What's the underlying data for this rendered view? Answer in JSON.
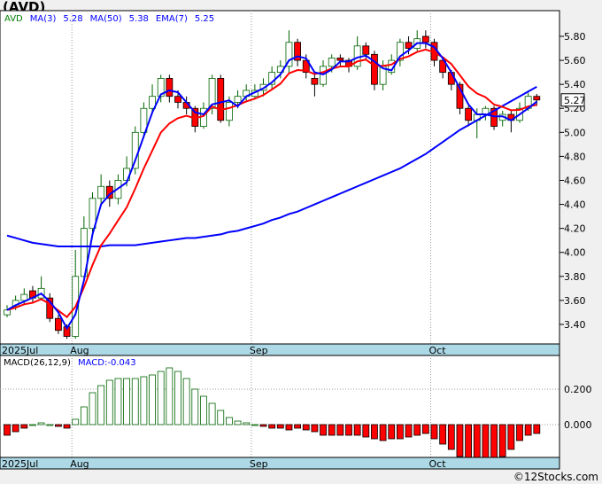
{
  "title": "(AVD)",
  "footer": "©12Stocks.com",
  "chart_data": [
    {
      "type": "candlestick",
      "legend": {
        "ticker": "AVD",
        "ma3_label": "MA(3)",
        "ma3_value": "5.28",
        "ma50_label": "MA(50)",
        "ma50_value": "5.38",
        "ema7_label": "EMA(7)",
        "ema7_value": "5.25"
      },
      "ylim": [
        3.25,
        5.95
      ],
      "yticks": [
        "3.40",
        "3.60",
        "3.80",
        "4.00",
        "4.20",
        "4.40",
        "4.60",
        "4.80",
        "5.00",
        "5.20",
        "5.40",
        "5.60",
        "5.80"
      ],
      "last_price": "5.27",
      "xticks": [
        {
          "label": "2025Jul",
          "index": 0
        },
        {
          "label": "Aug",
          "index": 8
        },
        {
          "label": "Sep",
          "index": 29
        },
        {
          "label": "Oct",
          "index": 50
        }
      ],
      "colors": {
        "up": "#ffffff",
        "down": "#ff0000",
        "ma": "#0000ff",
        "ema": "#ff0000",
        "grid": "#999999",
        "band": "#add8e6"
      },
      "candles": [
        [
          3.48,
          3.56,
          3.46,
          3.52
        ],
        [
          3.55,
          3.64,
          3.52,
          3.6
        ],
        [
          3.6,
          3.7,
          3.56,
          3.65
        ],
        [
          3.68,
          3.72,
          3.58,
          3.62
        ],
        [
          3.62,
          3.8,
          3.6,
          3.7
        ],
        [
          3.62,
          3.66,
          3.42,
          3.45
        ],
        [
          3.45,
          3.48,
          3.32,
          3.35
        ],
        [
          3.38,
          3.4,
          3.28,
          3.3
        ],
        [
          3.3,
          4.02,
          3.28,
          3.8
        ],
        [
          3.8,
          4.3,
          3.78,
          4.2
        ],
        [
          4.2,
          4.5,
          4.15,
          4.45
        ],
        [
          4.45,
          4.65,
          4.4,
          4.55
        ],
        [
          4.55,
          4.6,
          4.38,
          4.45
        ],
        [
          4.45,
          4.65,
          4.4,
          4.6
        ],
        [
          4.6,
          4.8,
          4.55,
          4.7
        ],
        [
          4.7,
          5.05,
          4.65,
          5.0
        ],
        [
          5.0,
          5.25,
          4.95,
          5.2
        ],
        [
          5.2,
          5.4,
          5.15,
          5.3
        ],
        [
          5.3,
          5.48,
          5.25,
          5.45
        ],
        [
          5.45,
          5.48,
          5.25,
          5.3
        ],
        [
          5.3,
          5.35,
          5.2,
          5.25
        ],
        [
          5.25,
          5.3,
          5.15,
          5.2
        ],
        [
          5.2,
          5.22,
          5.0,
          5.05
        ],
        [
          5.05,
          5.25,
          5.03,
          5.2
        ],
        [
          5.2,
          5.48,
          5.15,
          5.45
        ],
        [
          5.45,
          5.48,
          5.08,
          5.1
        ],
        [
          5.1,
          5.3,
          5.05,
          5.25
        ],
        [
          5.25,
          5.35,
          5.2,
          5.3
        ],
        [
          5.3,
          5.4,
          5.25,
          5.35
        ],
        [
          5.3,
          5.4,
          5.28,
          5.35
        ],
        [
          5.35,
          5.45,
          5.3,
          5.4
        ],
        [
          5.4,
          5.55,
          5.35,
          5.5
        ],
        [
          5.5,
          5.6,
          5.45,
          5.55
        ],
        [
          5.55,
          5.85,
          5.5,
          5.75
        ],
        [
          5.75,
          5.78,
          5.55,
          5.6
        ],
        [
          5.6,
          5.65,
          5.45,
          5.5
        ],
        [
          5.45,
          5.5,
          5.3,
          5.4
        ],
        [
          5.4,
          5.6,
          5.38,
          5.55
        ],
        [
          5.55,
          5.65,
          5.5,
          5.62
        ],
        [
          5.62,
          5.65,
          5.55,
          5.6
        ],
        [
          5.6,
          5.62,
          5.5,
          5.55
        ],
        [
          5.55,
          5.8,
          5.52,
          5.72
        ],
        [
          5.72,
          5.75,
          5.6,
          5.65
        ],
        [
          5.65,
          5.68,
          5.35,
          5.4
        ],
        [
          5.4,
          5.6,
          5.35,
          5.55
        ],
        [
          5.5,
          5.65,
          5.48,
          5.6
        ],
        [
          5.6,
          5.78,
          5.55,
          5.75
        ],
        [
          5.75,
          5.8,
          5.65,
          5.7
        ],
        [
          5.7,
          5.85,
          5.68,
          5.78
        ],
        [
          5.8,
          5.85,
          5.7,
          5.75
        ],
        [
          5.75,
          5.78,
          5.55,
          5.6
        ],
        [
          5.6,
          5.62,
          5.45,
          5.5
        ],
        [
          5.5,
          5.52,
          5.35,
          5.4
        ],
        [
          5.4,
          5.42,
          5.15,
          5.2
        ],
        [
          5.2,
          5.22,
          5.05,
          5.1
        ],
        [
          5.1,
          5.2,
          4.95,
          5.15
        ],
        [
          5.15,
          5.22,
          5.1,
          5.2
        ],
        [
          5.2,
          5.22,
          5.02,
          5.05
        ],
        [
          5.1,
          5.18,
          5.05,
          5.15
        ],
        [
          5.15,
          5.18,
          5.0,
          5.1
        ],
        [
          5.1,
          5.25,
          5.08,
          5.2
        ],
        [
          5.2,
          5.33,
          5.18,
          5.3
        ],
        [
          5.3,
          5.32,
          5.22,
          5.27
        ]
      ],
      "ma50": [
        4.14,
        4.12,
        4.1,
        4.08,
        4.07,
        4.06,
        4.05,
        4.05,
        4.05,
        4.05,
        4.05,
        4.05,
        4.06,
        4.06,
        4.06,
        4.06,
        4.07,
        4.08,
        4.09,
        4.1,
        4.11,
        4.12,
        4.12,
        4.13,
        4.14,
        4.15,
        4.17,
        4.18,
        4.2,
        4.22,
        4.24,
        4.27,
        4.29,
        4.32,
        4.34,
        4.37,
        4.4,
        4.43,
        4.46,
        4.49,
        4.52,
        4.55,
        4.58,
        4.61,
        4.64,
        4.67,
        4.7,
        4.74,
        4.78,
        4.82,
        4.87,
        4.92,
        4.97,
        5.02,
        5.06,
        5.1,
        5.14,
        5.18,
        5.22,
        5.26,
        5.3,
        5.34,
        5.38
      ]
    },
    {
      "type": "bar",
      "legend": {
        "label": "MACD(26,12,9)",
        "value_label": "MACD:-0.043"
      },
      "ylim": [
        -0.18,
        0.34
      ],
      "yticks": [
        "0.200",
        "0.000"
      ],
      "xticks": [
        {
          "label": "2025Jul",
          "index": 0
        },
        {
          "label": "Aug",
          "index": 8
        },
        {
          "label": "Sep",
          "index": 29
        },
        {
          "label": "Oct",
          "index": 50
        }
      ],
      "colors": {
        "up": "#ffffff",
        "down": "#ff0000"
      },
      "values": [
        -0.06,
        -0.04,
        -0.02,
        0.0,
        0.01,
        0.0,
        -0.01,
        -0.02,
        0.03,
        0.1,
        0.18,
        0.22,
        0.25,
        0.26,
        0.26,
        0.26,
        0.27,
        0.28,
        0.3,
        0.32,
        0.3,
        0.26,
        0.2,
        0.16,
        0.12,
        0.08,
        0.04,
        0.02,
        0.01,
        0.0,
        -0.01,
        -0.02,
        -0.02,
        -0.03,
        -0.02,
        -0.03,
        -0.04,
        -0.06,
        -0.06,
        -0.06,
        -0.06,
        -0.06,
        -0.07,
        -0.08,
        -0.09,
        -0.08,
        -0.08,
        -0.07,
        -0.06,
        -0.05,
        -0.08,
        -0.11,
        -0.14,
        -0.18,
        -0.2,
        -0.2,
        -0.2,
        -0.2,
        -0.18,
        -0.14,
        -0.09,
        -0.06,
        -0.05
      ]
    }
  ]
}
